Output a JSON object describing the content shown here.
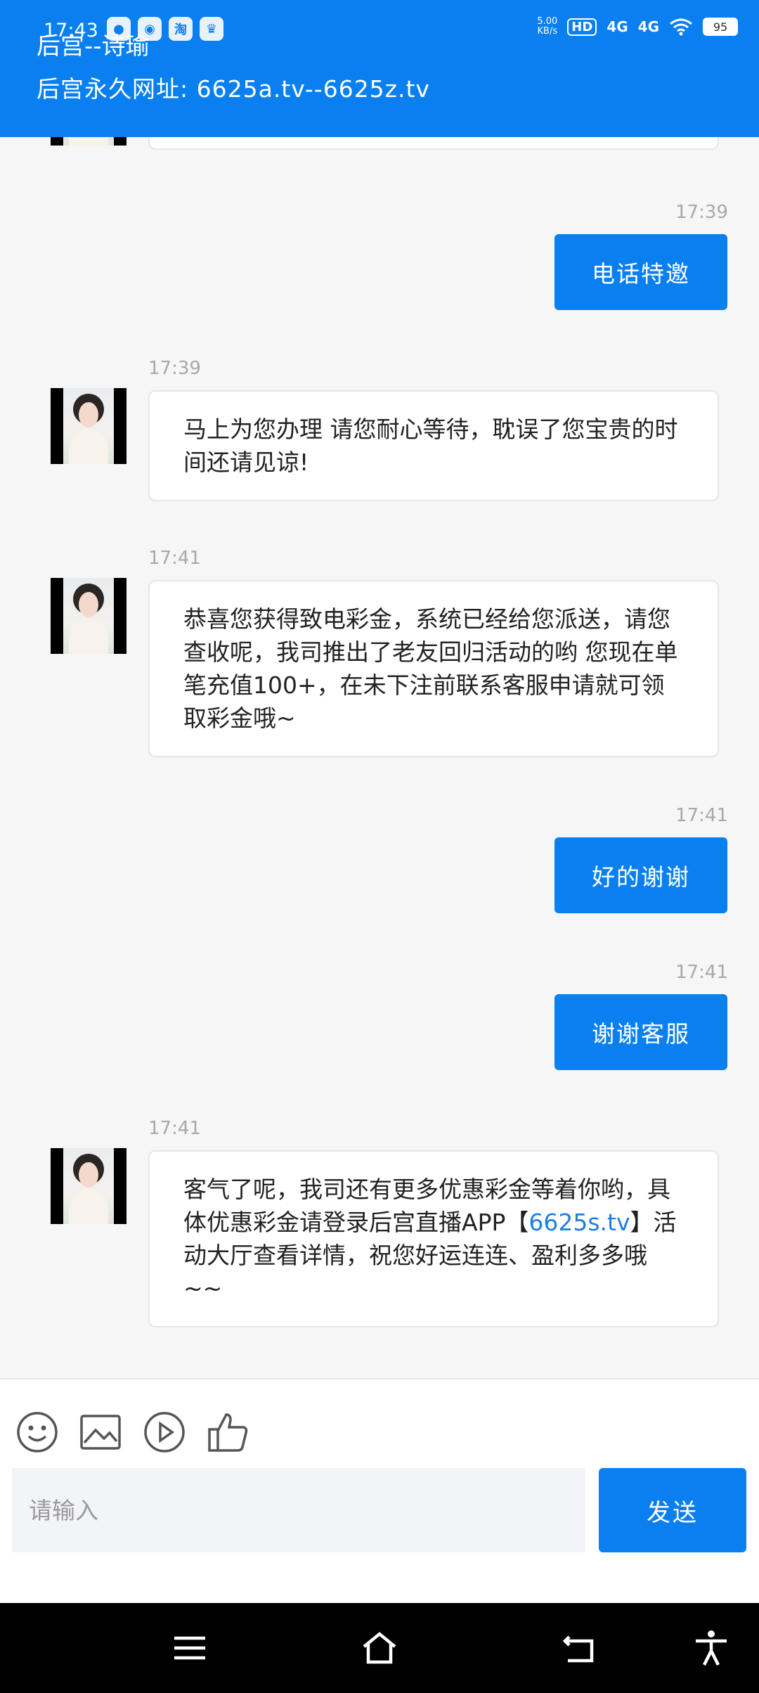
{
  "status_bar": {
    "time": "17:43",
    "apps": [
      "淘"
    ],
    "net_speed_value": "5.00",
    "net_speed_unit": "KB/s",
    "hd": "HD",
    "signal_1": "4G",
    "signal_2": "4G",
    "battery": "95"
  },
  "header": {
    "title": "后宫--诗瑜",
    "subtitle": "后宫永久网址: 6625a.tv--6625z.tv"
  },
  "messages": [
    {
      "side": "right",
      "time": "17:39",
      "text": "电话特邀"
    },
    {
      "side": "left",
      "time": "17:39",
      "text": "马上为您办理 请您耐心等待，耽误了您宝贵的时间还请见谅!"
    },
    {
      "side": "left",
      "time": "17:41",
      "text": "恭喜您获得致电彩金，系统已经给您派送，请您查收呢，我司推出了老友回归活动的哟 您现在单笔充值100+，在未下注前联系客服申请就可领取彩金哦~"
    },
    {
      "side": "right",
      "time": "17:41",
      "text": "好的谢谢"
    },
    {
      "side": "right",
      "time": "17:41",
      "text": "谢谢客服"
    },
    {
      "side": "left",
      "time": "17:41",
      "text_before": "客气了呢，我司还有更多优惠彩金等着你哟，具体优惠彩金请登录后宫直播APP【",
      "link": "6625s.tv",
      "text_after": "】活动大厅查看详情，祝您好运连连、盈利多多哦~~"
    }
  ],
  "input": {
    "placeholder": "请输入",
    "send_label": "发送"
  },
  "toolbar_icons": [
    "smiley-icon",
    "image-icon",
    "video-icon",
    "thumbs-up-icon"
  ],
  "nav_icons": [
    "menu-icon",
    "home-icon",
    "back-icon",
    "accessibility-icon"
  ],
  "colors": {
    "primary": "#0a7ff0",
    "link": "#1f7fe0"
  }
}
